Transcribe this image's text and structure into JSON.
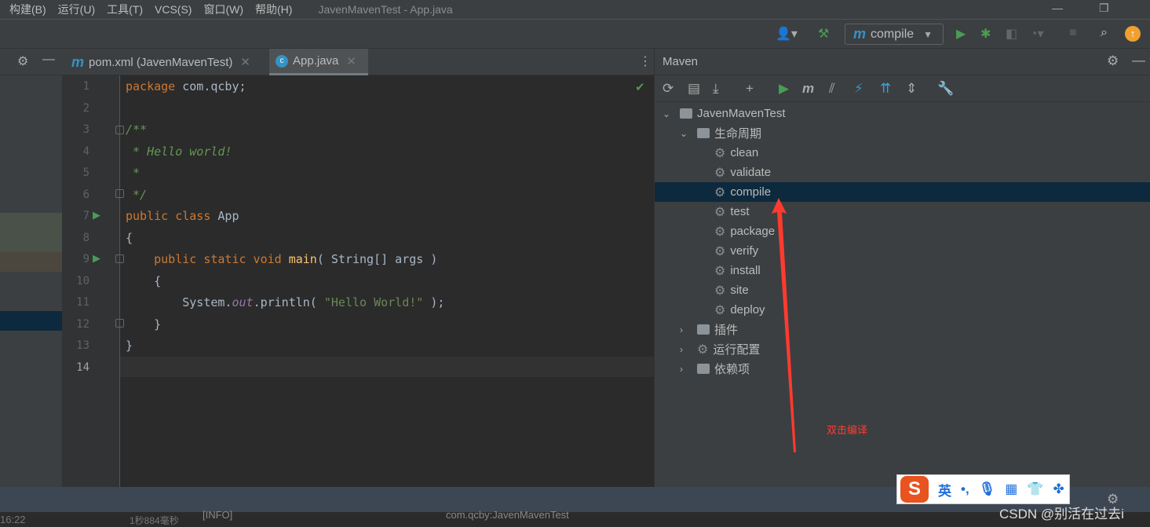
{
  "menu": {
    "items": [
      "构建(B)",
      "运行(U)",
      "工具(T)",
      "VCS(S)",
      "窗口(W)",
      "帮助(H)"
    ],
    "window_title": "JavenMavenTest - App.java"
  },
  "toolbar": {
    "run_config": "compile"
  },
  "tabs": [
    {
      "label": "pom.xml (JavenMavenTest)",
      "icon": "maven-icon"
    },
    {
      "label": "App.java",
      "icon": "java-class-icon",
      "active": true
    }
  ],
  "editor": {
    "line_numbers": [
      "1",
      "2",
      "3",
      "4",
      "5",
      "6",
      "7",
      "8",
      "9",
      "10",
      "11",
      "12",
      "13",
      "14"
    ]
  },
  "maven": {
    "title": "Maven",
    "project": "JavenMavenTest",
    "lifecycle": "生命周期",
    "phases": [
      "clean",
      "validate",
      "compile",
      "test",
      "package",
      "verify",
      "install",
      "site",
      "deploy"
    ],
    "selected": "compile",
    "plugins": "插件",
    "run_configs": "运行配置",
    "dependencies": "依赖项"
  },
  "annotation": "双击编译",
  "bottom": {
    "time": "16:22",
    "duration": "1秒884毫秒",
    "log": "[INFO]",
    "log2": "com.qcby:JavenMavenTest"
  },
  "ime": {
    "mode": "英",
    "punct": "•,"
  },
  "watermark": "CSDN @别活在过去i",
  "colors": {
    "accent": "#3592c4",
    "run": "#499c54",
    "selection": "#0d293e",
    "arrow": "#ff3b30"
  }
}
